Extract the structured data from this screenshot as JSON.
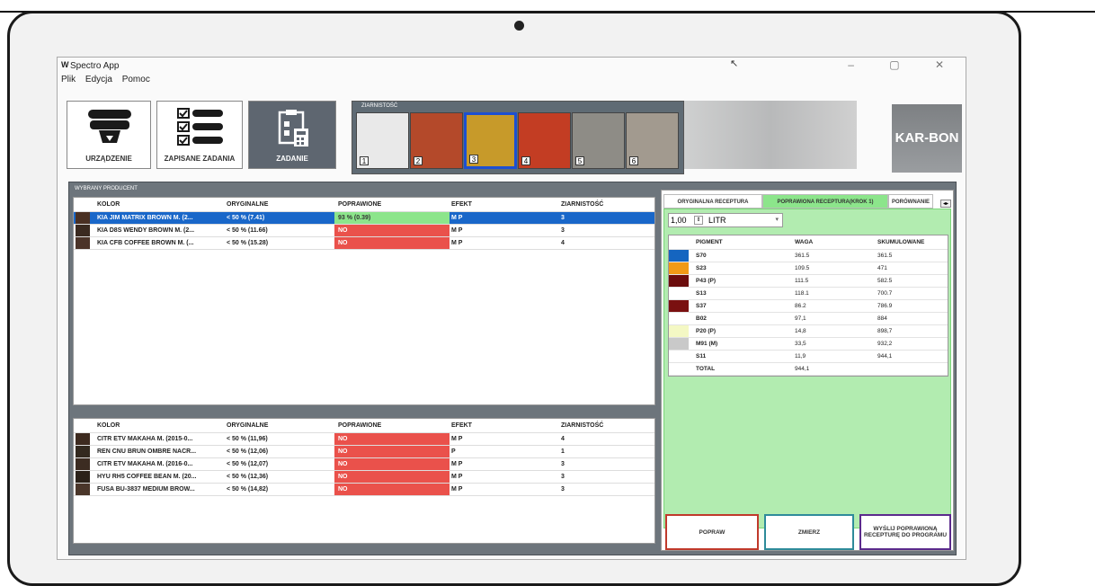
{
  "window": {
    "logo": "W",
    "title": "Spectro App",
    "controls": "–  ▢  ✕",
    "cursor": "↖"
  },
  "menu": [
    "Plik",
    "Edycja",
    "Pomoc"
  ],
  "toolbar": {
    "device": "URZĄDZENIE",
    "saved": "ZAPISANE ZADANIA",
    "task": "ZADANIE"
  },
  "grain": {
    "legend": "ZIARNISTOŚĆ",
    "items": [
      {
        "num": "1",
        "color": "#e9e9e9"
      },
      {
        "num": "2",
        "color": "#b4492a"
      },
      {
        "num": "3",
        "color": "#c79a2a"
      },
      {
        "num": "4",
        "color": "#c33d23"
      },
      {
        "num": "5",
        "color": "#8e8c86"
      },
      {
        "num": "6",
        "color": "#a29a8f"
      }
    ]
  },
  "brand": "KAR-BON",
  "producer_panel": {
    "legend": "WYBRANY PRODUCENT",
    "headers": [
      "KOLOR",
      "ORYGINALNE",
      "POPRAWIONE",
      "EFEKT",
      "ZIARNISTOŚĆ"
    ],
    "rows": [
      {
        "swatch": "#4a3023",
        "kolor": "KIA JIM MATRIX BROWN M. (2...",
        "orig": "< 50 %    (7.41)",
        "pop": "93 %    (0.39)",
        "pop_status": "good",
        "efekt": "M P",
        "ziarn": "3",
        "selected": true
      },
      {
        "swatch": "#3a2a20",
        "kolor": "KIA D8S WENDY BROWN M. (2...",
        "orig": "< 50 %    (11.66)",
        "pop": "NO",
        "pop_status": "bad",
        "efekt": "M P",
        "ziarn": "3",
        "selected": false
      },
      {
        "swatch": "#4b3429",
        "kolor": "KIA CFB COFFEE BROWN M. (...",
        "orig": "< 50 %    (15.28)",
        "pop": "NO",
        "pop_status": "bad",
        "efekt": "M P",
        "ziarn": "4",
        "selected": false
      }
    ]
  },
  "bottom_panel": {
    "headers": [
      "KOLOR",
      "ORYGINALNE",
      "POPRAWIONE",
      "EFEKT",
      "ZIARNISTOŚĆ"
    ],
    "rows": [
      {
        "swatch": "#3d2a1f",
        "kolor": "CITR ETV MAKAHA M. (2015-0...",
        "orig": "< 50 %    (11,96)",
        "pop": "NO",
        "efekt": "M P",
        "ziarn": "4"
      },
      {
        "swatch": "#33291f",
        "kolor": "REN CNU BRUN OMBRE NACR...",
        "orig": "< 50 %    (12,06)",
        "pop": "NO",
        "efekt": "P",
        "ziarn": "1"
      },
      {
        "swatch": "#3c2c22",
        "kolor": "CITR ETV MAKAHA M. (2016-0...",
        "orig": "< 50 %    (12,07)",
        "pop": "NO",
        "efekt": "M P",
        "ziarn": "3"
      },
      {
        "swatch": "#2b2119",
        "kolor": "HYU RH5 COFFEE BEAN M. (20...",
        "orig": "< 50 %    (12,36)",
        "pop": "NO",
        "efekt": "M P",
        "ziarn": "3"
      },
      {
        "swatch": "#4a362a",
        "kolor": "FUSA BU-3837 MEDIUM BROW...",
        "orig": "< 50 %    (14,82)",
        "pop": "NO",
        "efekt": "M P",
        "ziarn": "3"
      }
    ]
  },
  "recipe": {
    "tabs": [
      "ORYGINALNA RECEPTURA",
      "POPRAWIONA RECEPTURA(KROK 1)",
      "PORÓWNANIE"
    ],
    "quantity": "1,00",
    "unit": "LITR",
    "headers": [
      "PIGMENT",
      "WAGA",
      "SKUMULOWANE"
    ],
    "rows": [
      {
        "color": "#1565c0",
        "name": "S70",
        "waga": "361.5",
        "skum": "361.5"
      },
      {
        "color": "#f19a16",
        "name": "S23",
        "waga": "109.5",
        "skum": "471"
      },
      {
        "color": "#6b0d0d",
        "name": "P43 (P)",
        "waga": "111.5",
        "skum": "582.5"
      },
      {
        "color": "#ffffff",
        "name": "S13",
        "waga": "118.1",
        "skum": "700.7"
      },
      {
        "color": "#7a1010",
        "name": "S37",
        "waga": "86.2",
        "skum": "786.9"
      },
      {
        "color": "#ffffff",
        "name": "B02",
        "waga": "97,1",
        "skum": "884"
      },
      {
        "color": "#f4f8c4",
        "name": "P20 (P)",
        "waga": "14,8",
        "skum": "898,7"
      },
      {
        "color": "#c9c9c9",
        "name": "M91 (M)",
        "waga": "33,5",
        "skum": "932,2"
      },
      {
        "color": "#ffffff",
        "name": "S11",
        "waga": "11,9",
        "skum": "944,1"
      },
      {
        "color": "#ffffff",
        "name": "TOTAL",
        "waga": "944,1",
        "skum": ""
      }
    ],
    "btn_fix": "POPRAW",
    "btn_measure": "ZMIERZ",
    "btn_send": "WYŚLIJ POPRAWIONĄ RECEPTURĘ DO PROGRAMU"
  }
}
